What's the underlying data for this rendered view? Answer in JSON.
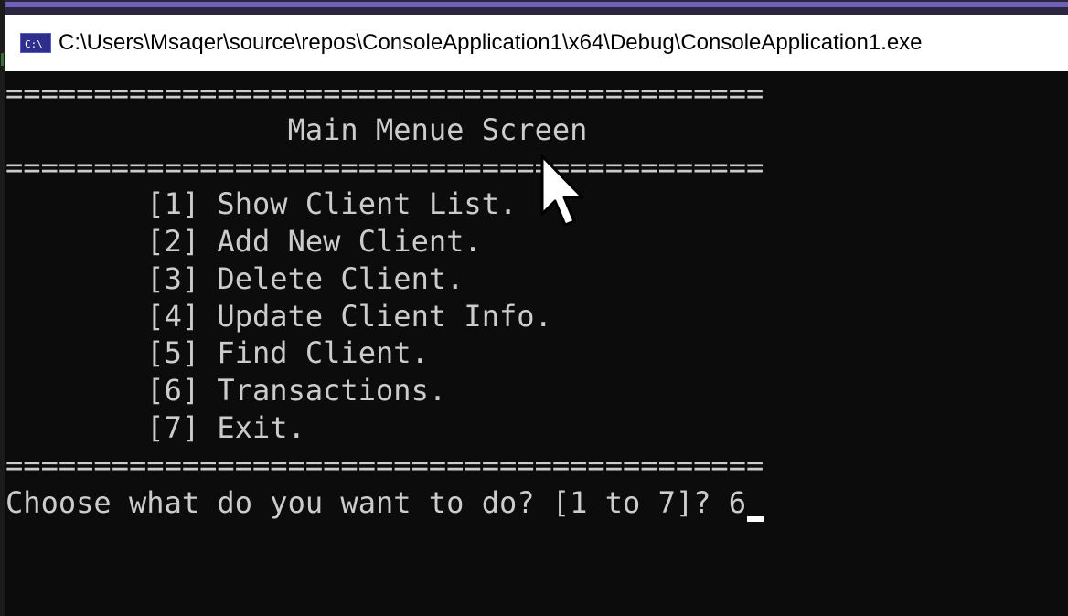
{
  "window": {
    "title": "C:\\Users\\Msaqer\\source\\repos\\ConsoleApplication1\\x64\\Debug\\ConsoleApplication1.exe",
    "icon": "console-app-icon",
    "icon_label": "C:\\"
  },
  "console": {
    "separator_top": "===========================================",
    "heading": "                Main Menue Screen",
    "separator_mid": "===========================================",
    "menu": [
      "        [1] Show Client List.",
      "        [2] Add New Client.",
      "        [3] Delete Client.",
      "        [4] Update Client Info.",
      "        [5] Find Client.",
      "        [6] Transactions.",
      "        [7] Exit."
    ],
    "separator_bottom": "===========================================",
    "prompt": "Choose what do you want to do? [1 to 7]? ",
    "input_value": "6"
  },
  "colors": {
    "console_background": "#0c0c0c",
    "console_text": "#cccccc",
    "titlebar_background": "#ffffff",
    "accent": "#6f5fb8"
  }
}
